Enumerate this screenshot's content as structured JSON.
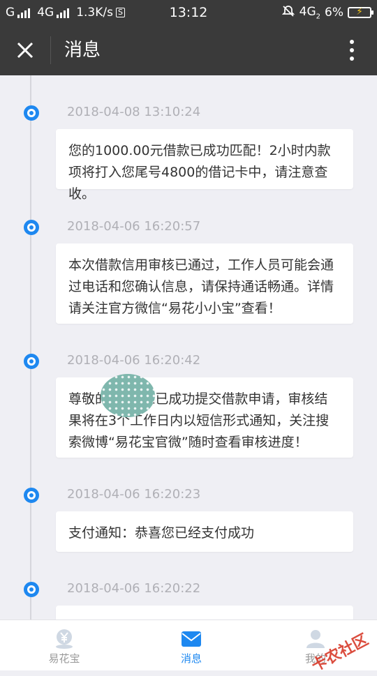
{
  "statusbar": {
    "carrier1": "G",
    "carrier2": "4G",
    "speed": "1.3K/s",
    "sim": "S",
    "time": "13:12",
    "network": "4G",
    "network_sub": "2",
    "battery": "6%"
  },
  "appbar": {
    "title": "消息"
  },
  "messages": [
    {
      "time": "2018-04-08 13:10:24",
      "text": "您的1000.00元借款已成功匹配！2小时内款项将打入您尾号4800的借记卡中，请注意查收。"
    },
    {
      "time": "2018-04-06 16:20:57",
      "text": "本次借款信用审核已通过，工作人员可能会通过电话和您确认信息，请保持通话畅通。详情请关注官方微信“易花小小宝”查看！"
    },
    {
      "time": "2018-04-06 16:20:42",
      "text": "尊敬的        您已成功提交借款申请，审核结果将在3个工作日内以短信形式通知，关注搜索微博“易花宝官微”随时查看审核进度！"
    },
    {
      "time": "2018-04-06 16:20:23",
      "text": "支付通知：恭喜您已经支付成功"
    },
    {
      "time": "2018-04-06 16:20:22",
      "text": ""
    }
  ],
  "tabs": [
    {
      "label": "易花宝"
    },
    {
      "label": "消息"
    },
    {
      "label": "我的"
    }
  ],
  "watermark": "卡农社区",
  "colors": {
    "accent": "#1e88f0",
    "appbar": "#3a3a3a",
    "background": "#efeff4"
  }
}
